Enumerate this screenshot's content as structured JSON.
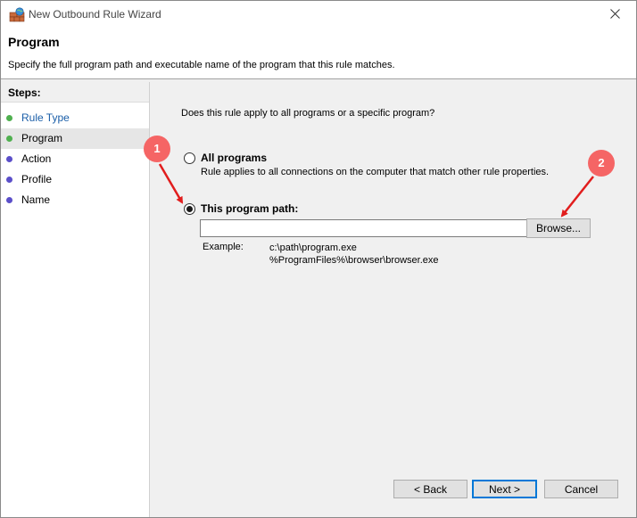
{
  "window": {
    "title": "New Outbound Rule Wizard"
  },
  "header": {
    "title": "Program",
    "description": "Specify the full program path and executable name of the program that this rule matches."
  },
  "steps": {
    "title": "Steps:",
    "items": [
      {
        "label": "Rule Type",
        "color": "#4fb04f",
        "text_color": "#1a5ea8"
      },
      {
        "label": "Program",
        "color": "#4fb04f",
        "text_color": "#000000"
      },
      {
        "label": "Action",
        "color": "#5b4fc9",
        "text_color": "#000000"
      },
      {
        "label": "Profile",
        "color": "#5b4fc9",
        "text_color": "#000000"
      },
      {
        "label": "Name",
        "color": "#5b4fc9",
        "text_color": "#000000"
      }
    ]
  },
  "main": {
    "question": "Does this rule apply to all programs or a specific program?",
    "all_programs": {
      "label": "All programs",
      "description": "Rule applies to all connections on the computer that match other rule properties.",
      "selected": false
    },
    "this_program": {
      "label": "This program path:",
      "selected": true,
      "value": "",
      "placeholder": ""
    },
    "browse_label": "Browse...",
    "example_label": "Example:",
    "example_values": [
      "c:\\path\\program.exe",
      "%ProgramFiles%\\browser\\browser.exe"
    ]
  },
  "footer": {
    "back_label": "< Back",
    "next_label": "Next >",
    "cancel_label": "Cancel"
  },
  "annotations": [
    {
      "number": "1",
      "color": "#f56565"
    },
    {
      "number": "2",
      "color": "#f56565"
    }
  ],
  "icons": {
    "app": "firewall-icon",
    "close": "close-icon"
  }
}
